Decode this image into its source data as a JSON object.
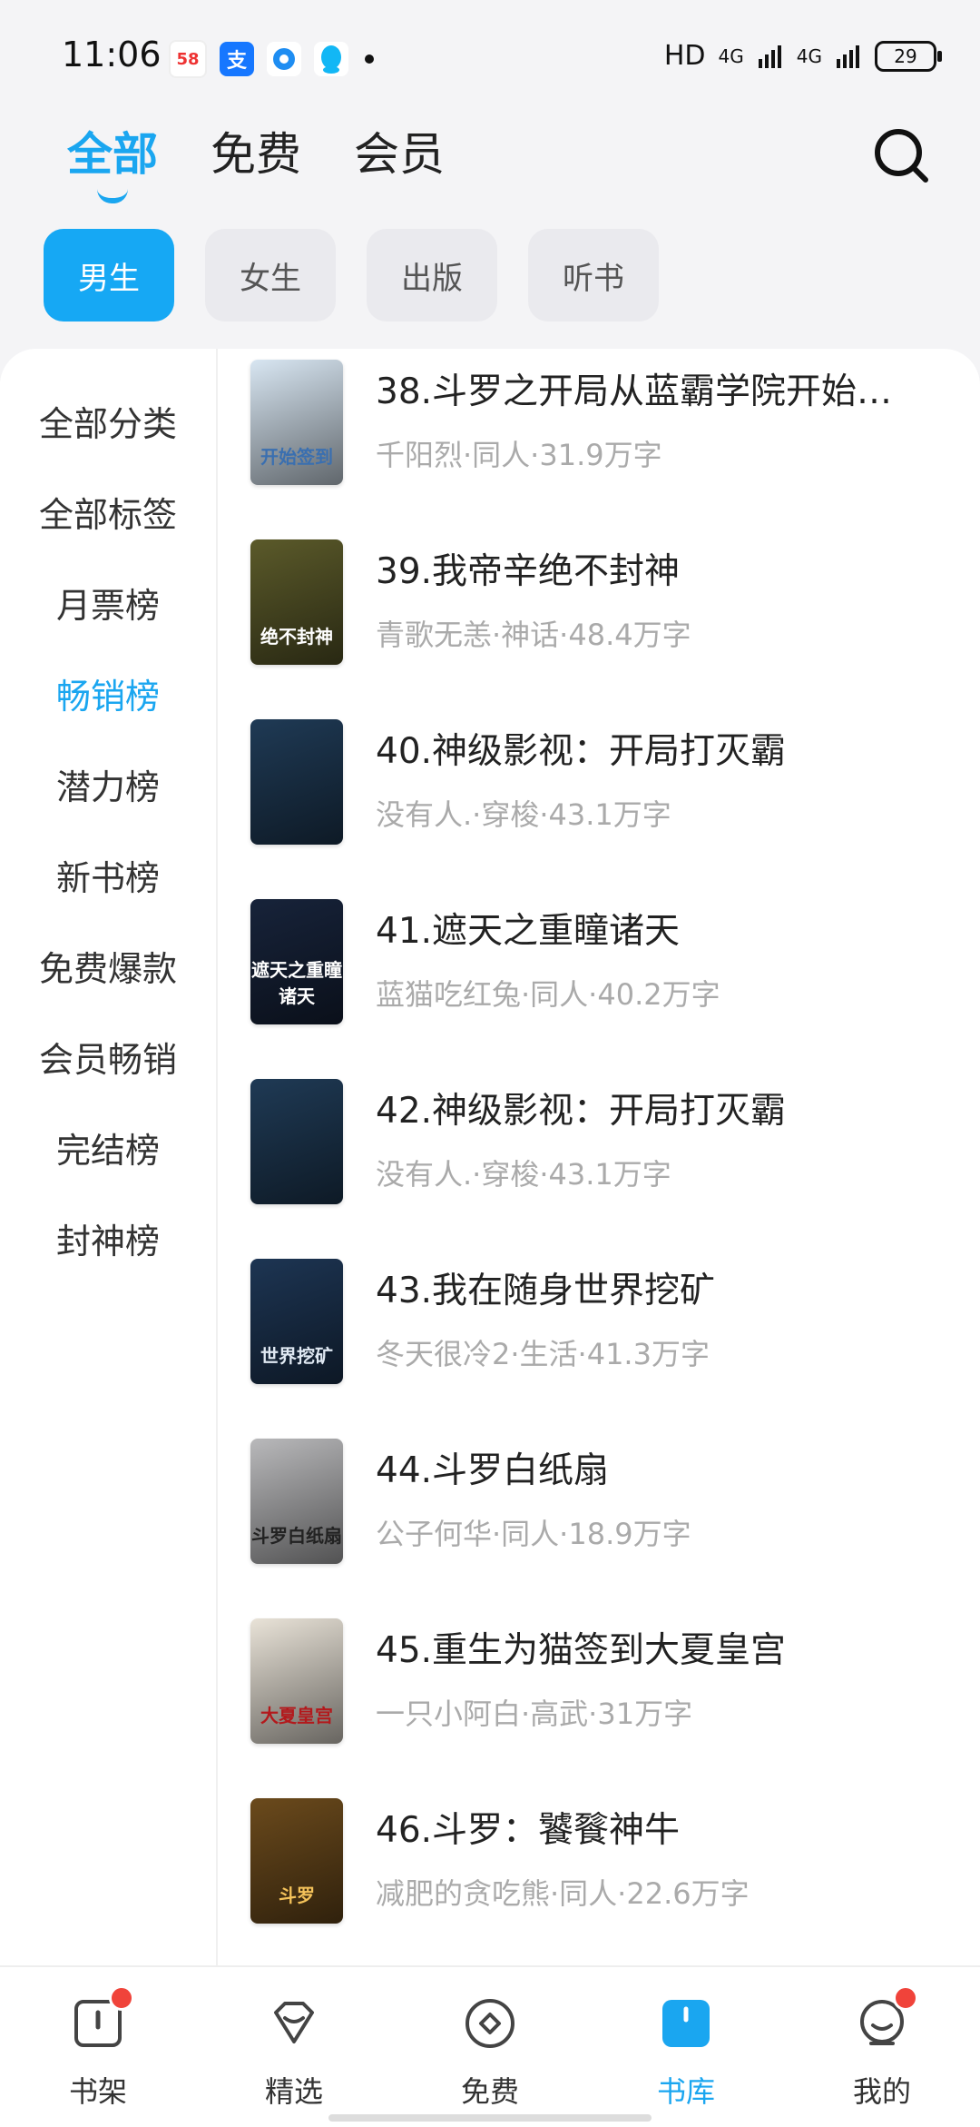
{
  "status": {
    "time": "11:06",
    "hd": "HD",
    "net1": "4G",
    "net2": "4G",
    "battery": "29"
  },
  "top_tabs": [
    "全部",
    "免费",
    "会员"
  ],
  "chips": [
    "男生",
    "女生",
    "出版",
    "听书"
  ],
  "sidebar": [
    "全部分类",
    "全部标签",
    "月票榜",
    "畅销榜",
    "潜力榜",
    "新书榜",
    "免费爆款",
    "会员畅销",
    "完结榜",
    "封神榜"
  ],
  "books": [
    {
      "title": "38.斗罗之开局从蓝霸学院开始…",
      "meta": "千阳烈·同人·31.9万字",
      "cover_text": "开始签到",
      "cover_color": "#d8e6f2",
      "text_color": "#3a6fb0"
    },
    {
      "title": "39.我帝辛绝不封神",
      "meta": "青歌无恙·神话·48.4万字",
      "cover_text": "绝不封神",
      "cover_color": "#5b5a2a",
      "text_color": "#ffffff"
    },
    {
      "title": "40.神级影视：开局打灭霸",
      "meta": "没有人.·穿梭·43.1万字",
      "cover_text": "",
      "cover_color": "#1f3a55",
      "text_color": "#ffffff"
    },
    {
      "title": "41.遮天之重瞳诸天",
      "meta": "蓝猫吃红兔·同人·40.2万字",
      "cover_text": "遮天之重瞳诸天",
      "cover_color": "#17233a",
      "text_color": "#ffffff"
    },
    {
      "title": "42.神级影视：开局打灭霸",
      "meta": "没有人.·穿梭·43.1万字",
      "cover_text": "",
      "cover_color": "#1f3a55",
      "text_color": "#ffffff"
    },
    {
      "title": "43.我在随身世界挖矿",
      "meta": "冬天很冷2·生活·41.3万字",
      "cover_text": "世界挖矿",
      "cover_color": "#1d3553",
      "text_color": "#dfe8f2"
    },
    {
      "title": "44.斗罗白纸扇",
      "meta": "公子何华·同人·18.9万字",
      "cover_text": "斗罗白纸扇",
      "cover_color": "#b9b9bb",
      "text_color": "#222222"
    },
    {
      "title": "45.重生为猫签到大夏皇宫",
      "meta": "一只小阿白·高武·31万字",
      "cover_text": "大夏皇宫",
      "cover_color": "#e9e3d8",
      "text_color": "#b3191c"
    },
    {
      "title": "46.斗罗：饕餮神牛",
      "meta": "减肥的贪吃熊·同人·22.6万字",
      "cover_text": "斗罗",
      "cover_color": "#6b4a1c",
      "text_color": "#f4c25a"
    }
  ],
  "bottom_nav": [
    "书架",
    "精选",
    "免费",
    "书库",
    "我的"
  ],
  "colors": {
    "accent": "#1aa6f0",
    "badge": "#f0433a"
  }
}
